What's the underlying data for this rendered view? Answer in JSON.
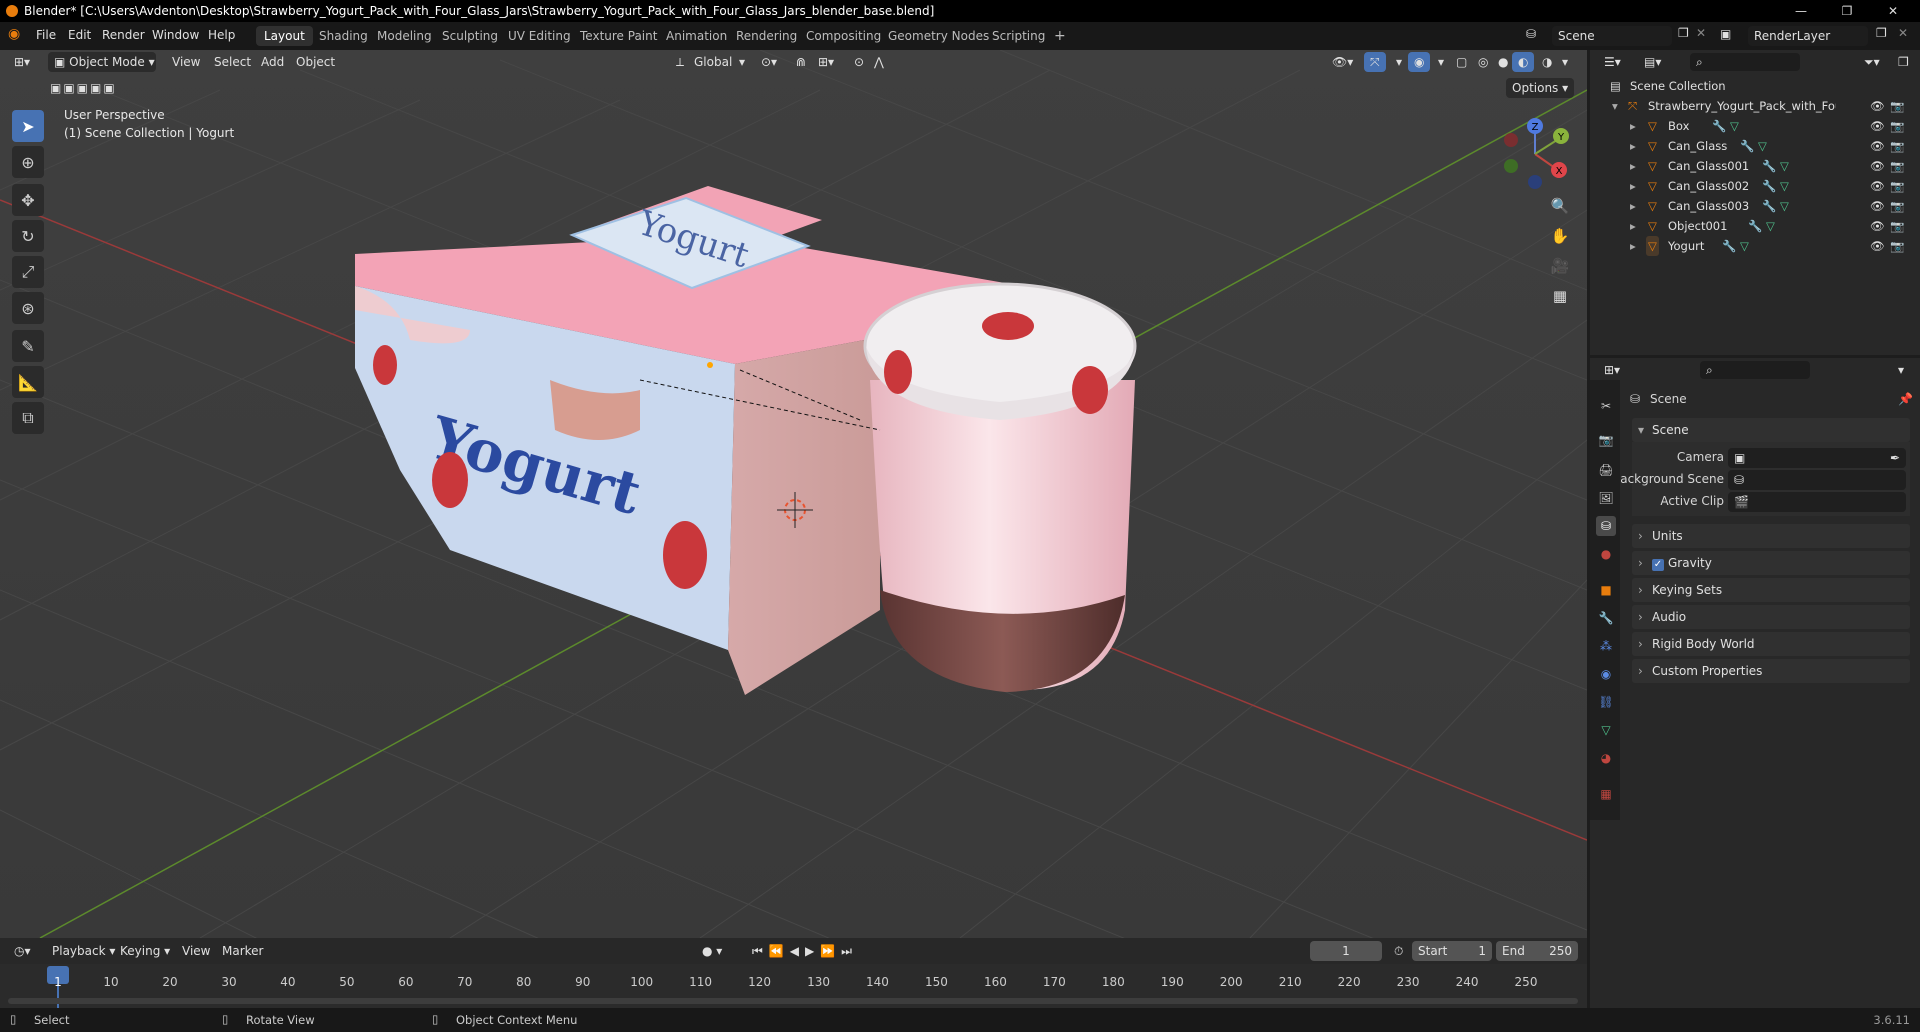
{
  "titlebar": {
    "title": "Blender* [C:\\Users\\Avdenton\\Desktop\\Strawberry_Yogurt_Pack_with_Four_Glass_Jars\\Strawberry_Yogurt_Pack_with_Four_Glass_Jars_blender_base.blend]",
    "minimize": "—",
    "maximize": "❐",
    "close": "✕"
  },
  "menu": {
    "items": [
      "File",
      "Edit",
      "Render",
      "Window",
      "Help"
    ],
    "workspaces": [
      "Layout",
      "Shading",
      "Modeling",
      "Sculpting",
      "UV Editing",
      "Texture Paint",
      "Animation",
      "Rendering",
      "Compositing",
      "Geometry Nodes",
      "Scripting"
    ],
    "add_tab": "+",
    "scene_label": "Scene",
    "view_layer_label": "RenderLayer"
  },
  "viewport": {
    "mode": "Object Mode",
    "menus": [
      "View",
      "Select",
      "Add",
      "Object"
    ],
    "orientation": "Global",
    "options": "Options",
    "perspective_label": "User Perspective",
    "collection_label": "(1) Scene Collection | Yogurt",
    "gizmo": {
      "x": "X",
      "y": "Y",
      "z": "Z"
    },
    "box_text": "Yogurt",
    "lid_text": "Yogurt"
  },
  "outliner": {
    "root": "Scene Collection",
    "collection": "Strawberry_Yogurt_Pack_with_Four_Gla",
    "objects": [
      "Box",
      "Can_Glass",
      "Can_Glass001",
      "Can_Glass002",
      "Can_Glass003",
      "Object001",
      "Yogurt"
    ]
  },
  "properties": {
    "context": "Scene",
    "panel_title": "Scene",
    "camera_label": "Camera",
    "background_scene_label": "Background Scene",
    "active_clip_label": "Active Clip",
    "sections": [
      "Units",
      "Gravity",
      "Keying Sets",
      "Audio",
      "Rigid Body World",
      "Custom Properties"
    ]
  },
  "timeline": {
    "menus": [
      "Playback",
      "Keying",
      "View",
      "Marker"
    ],
    "current_frame": "1",
    "start_label": "Start",
    "start_value": "1",
    "end_label": "End",
    "end_value": "250",
    "ruler": [
      "1",
      "10",
      "20",
      "30",
      "40",
      "50",
      "60",
      "70",
      "80",
      "90",
      "100",
      "110",
      "120",
      "130",
      "140",
      "150",
      "160",
      "170",
      "180",
      "190",
      "200",
      "210",
      "220",
      "230",
      "240",
      "250"
    ]
  },
  "status": {
    "select": "Select",
    "rotate": "Rotate View",
    "context_menu": "Object Context Menu",
    "version": "3.6.11"
  },
  "colors": {
    "accent": "#4772b3",
    "orange": "#e87d0d",
    "x_axis": "#c0463f",
    "y_axis": "#7fa33b",
    "box_pink": "#f2a2b4",
    "box_blue": "#c9d8ee"
  }
}
